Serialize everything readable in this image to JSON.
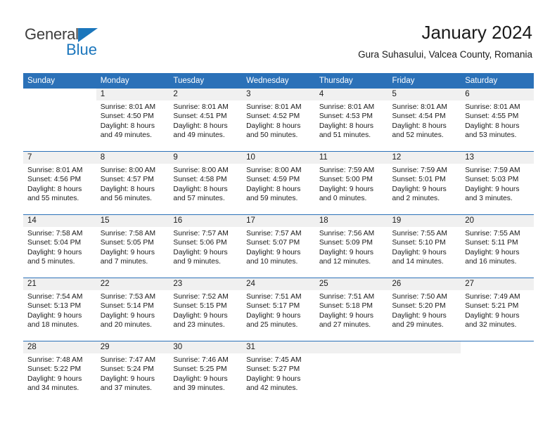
{
  "brand": {
    "word1": "General",
    "word2": "Blue",
    "triangle_color": "#1b76bc"
  },
  "header": {
    "title": "January 2024",
    "subtitle": "Gura Suhasului, Valcea County, Romania"
  },
  "colors": {
    "header_blue": "#2b71b8",
    "daynum_band": "#f0f0f0",
    "text": "#1a1a1a"
  },
  "calendar": {
    "day_names": [
      "Sunday",
      "Monday",
      "Tuesday",
      "Wednesday",
      "Thursday",
      "Friday",
      "Saturday"
    ],
    "weeks": [
      [
        {
          "day": "",
          "blank": true,
          "sunrise": "",
          "sunset": "",
          "daylight1": "",
          "daylight2": ""
        },
        {
          "day": "1",
          "sunrise": "Sunrise: 8:01 AM",
          "sunset": "Sunset: 4:50 PM",
          "daylight1": "Daylight: 8 hours",
          "daylight2": "and 49 minutes."
        },
        {
          "day": "2",
          "sunrise": "Sunrise: 8:01 AM",
          "sunset": "Sunset: 4:51 PM",
          "daylight1": "Daylight: 8 hours",
          "daylight2": "and 49 minutes."
        },
        {
          "day": "3",
          "sunrise": "Sunrise: 8:01 AM",
          "sunset": "Sunset: 4:52 PM",
          "daylight1": "Daylight: 8 hours",
          "daylight2": "and 50 minutes."
        },
        {
          "day": "4",
          "sunrise": "Sunrise: 8:01 AM",
          "sunset": "Sunset: 4:53 PM",
          "daylight1": "Daylight: 8 hours",
          "daylight2": "and 51 minutes."
        },
        {
          "day": "5",
          "sunrise": "Sunrise: 8:01 AM",
          "sunset": "Sunset: 4:54 PM",
          "daylight1": "Daylight: 8 hours",
          "daylight2": "and 52 minutes."
        },
        {
          "day": "6",
          "sunrise": "Sunrise: 8:01 AM",
          "sunset": "Sunset: 4:55 PM",
          "daylight1": "Daylight: 8 hours",
          "daylight2": "and 53 minutes."
        }
      ],
      [
        {
          "day": "7",
          "sunrise": "Sunrise: 8:01 AM",
          "sunset": "Sunset: 4:56 PM",
          "daylight1": "Daylight: 8 hours",
          "daylight2": "and 55 minutes."
        },
        {
          "day": "8",
          "sunrise": "Sunrise: 8:00 AM",
          "sunset": "Sunset: 4:57 PM",
          "daylight1": "Daylight: 8 hours",
          "daylight2": "and 56 minutes."
        },
        {
          "day": "9",
          "sunrise": "Sunrise: 8:00 AM",
          "sunset": "Sunset: 4:58 PM",
          "daylight1": "Daylight: 8 hours",
          "daylight2": "and 57 minutes."
        },
        {
          "day": "10",
          "sunrise": "Sunrise: 8:00 AM",
          "sunset": "Sunset: 4:59 PM",
          "daylight1": "Daylight: 8 hours",
          "daylight2": "and 59 minutes."
        },
        {
          "day": "11",
          "sunrise": "Sunrise: 7:59 AM",
          "sunset": "Sunset: 5:00 PM",
          "daylight1": "Daylight: 9 hours",
          "daylight2": "and 0 minutes."
        },
        {
          "day": "12",
          "sunrise": "Sunrise: 7:59 AM",
          "sunset": "Sunset: 5:01 PM",
          "daylight1": "Daylight: 9 hours",
          "daylight2": "and 2 minutes."
        },
        {
          "day": "13",
          "sunrise": "Sunrise: 7:59 AM",
          "sunset": "Sunset: 5:03 PM",
          "daylight1": "Daylight: 9 hours",
          "daylight2": "and 3 minutes."
        }
      ],
      [
        {
          "day": "14",
          "sunrise": "Sunrise: 7:58 AM",
          "sunset": "Sunset: 5:04 PM",
          "daylight1": "Daylight: 9 hours",
          "daylight2": "and 5 minutes."
        },
        {
          "day": "15",
          "sunrise": "Sunrise: 7:58 AM",
          "sunset": "Sunset: 5:05 PM",
          "daylight1": "Daylight: 9 hours",
          "daylight2": "and 7 minutes."
        },
        {
          "day": "16",
          "sunrise": "Sunrise: 7:57 AM",
          "sunset": "Sunset: 5:06 PM",
          "daylight1": "Daylight: 9 hours",
          "daylight2": "and 9 minutes."
        },
        {
          "day": "17",
          "sunrise": "Sunrise: 7:57 AM",
          "sunset": "Sunset: 5:07 PM",
          "daylight1": "Daylight: 9 hours",
          "daylight2": "and 10 minutes."
        },
        {
          "day": "18",
          "sunrise": "Sunrise: 7:56 AM",
          "sunset": "Sunset: 5:09 PM",
          "daylight1": "Daylight: 9 hours",
          "daylight2": "and 12 minutes."
        },
        {
          "day": "19",
          "sunrise": "Sunrise: 7:55 AM",
          "sunset": "Sunset: 5:10 PM",
          "daylight1": "Daylight: 9 hours",
          "daylight2": "and 14 minutes."
        },
        {
          "day": "20",
          "sunrise": "Sunrise: 7:55 AM",
          "sunset": "Sunset: 5:11 PM",
          "daylight1": "Daylight: 9 hours",
          "daylight2": "and 16 minutes."
        }
      ],
      [
        {
          "day": "21",
          "sunrise": "Sunrise: 7:54 AM",
          "sunset": "Sunset: 5:13 PM",
          "daylight1": "Daylight: 9 hours",
          "daylight2": "and 18 minutes."
        },
        {
          "day": "22",
          "sunrise": "Sunrise: 7:53 AM",
          "sunset": "Sunset: 5:14 PM",
          "daylight1": "Daylight: 9 hours",
          "daylight2": "and 20 minutes."
        },
        {
          "day": "23",
          "sunrise": "Sunrise: 7:52 AM",
          "sunset": "Sunset: 5:15 PM",
          "daylight1": "Daylight: 9 hours",
          "daylight2": "and 23 minutes."
        },
        {
          "day": "24",
          "sunrise": "Sunrise: 7:51 AM",
          "sunset": "Sunset: 5:17 PM",
          "daylight1": "Daylight: 9 hours",
          "daylight2": "and 25 minutes."
        },
        {
          "day": "25",
          "sunrise": "Sunrise: 7:51 AM",
          "sunset": "Sunset: 5:18 PM",
          "daylight1": "Daylight: 9 hours",
          "daylight2": "and 27 minutes."
        },
        {
          "day": "26",
          "sunrise": "Sunrise: 7:50 AM",
          "sunset": "Sunset: 5:20 PM",
          "daylight1": "Daylight: 9 hours",
          "daylight2": "and 29 minutes."
        },
        {
          "day": "27",
          "sunrise": "Sunrise: 7:49 AM",
          "sunset": "Sunset: 5:21 PM",
          "daylight1": "Daylight: 9 hours",
          "daylight2": "and 32 minutes."
        }
      ],
      [
        {
          "day": "28",
          "sunrise": "Sunrise: 7:48 AM",
          "sunset": "Sunset: 5:22 PM",
          "daylight1": "Daylight: 9 hours",
          "daylight2": "and 34 minutes."
        },
        {
          "day": "29",
          "sunrise": "Sunrise: 7:47 AM",
          "sunset": "Sunset: 5:24 PM",
          "daylight1": "Daylight: 9 hours",
          "daylight2": "and 37 minutes."
        },
        {
          "day": "30",
          "sunrise": "Sunrise: 7:46 AM",
          "sunset": "Sunset: 5:25 PM",
          "daylight1": "Daylight: 9 hours",
          "daylight2": "and 39 minutes."
        },
        {
          "day": "31",
          "sunrise": "Sunrise: 7:45 AM",
          "sunset": "Sunset: 5:27 PM",
          "daylight1": "Daylight: 9 hours",
          "daylight2": "and 42 minutes."
        },
        {
          "day": "",
          "empty": true,
          "sunrise": "",
          "sunset": "",
          "daylight1": "",
          "daylight2": ""
        },
        {
          "day": "",
          "empty": true,
          "sunrise": "",
          "sunset": "",
          "daylight1": "",
          "daylight2": ""
        },
        {
          "day": "",
          "blank": true,
          "sunrise": "",
          "sunset": "",
          "daylight1": "",
          "daylight2": ""
        }
      ]
    ]
  }
}
